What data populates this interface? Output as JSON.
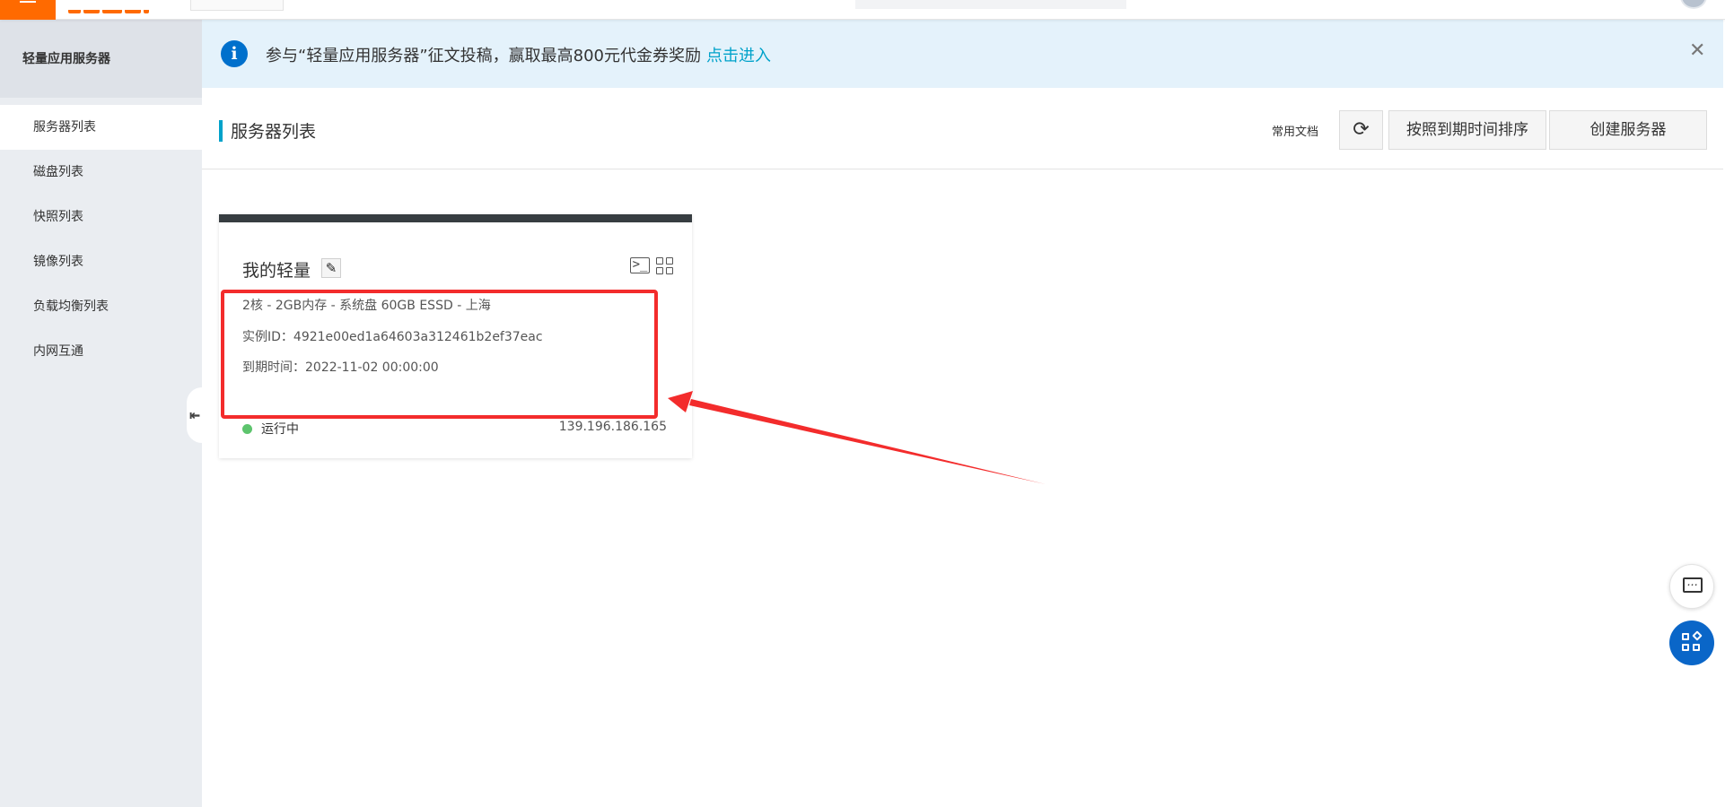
{
  "sidebar": {
    "title": "轻量应用服务器",
    "items": [
      {
        "label": "服务器列表",
        "active": true
      },
      {
        "label": "磁盘列表"
      },
      {
        "label": "快照列表"
      },
      {
        "label": "镜像列表"
      },
      {
        "label": "负载均衡列表"
      },
      {
        "label": "内网互通"
      }
    ]
  },
  "notice": {
    "text": "参与“轻量应用服务器”征文投稿，赢取最高800元代金券奖励",
    "link": "点击进入",
    "close": "✕"
  },
  "header": {
    "title": "服务器列表",
    "docs": "常用文档",
    "refresh_icon": "⟳",
    "sort_label": "按照到期时间排序",
    "create_label": "创建服务器"
  },
  "server": {
    "name": "我的轻量",
    "spec": "2核 - 2GB内存 - 系统盘 60GB ESSD - 上海",
    "instance_id_label": "实例ID：",
    "instance_id": "4921e00ed1a64603a312461b2ef37eac",
    "expiry_label": "到期时间：",
    "expiry": "2022-11-02 00:00:00",
    "status": "运行中",
    "ip": "139.196.186.165"
  },
  "colors": {
    "accent": "#00a2ca",
    "brand": "#ff6a00",
    "status_running": "#5dc46d",
    "annotation": "#f32c2c"
  },
  "icons": {
    "edit": "pencil-icon",
    "terminal": "terminal-icon",
    "grid": "grid-icon",
    "info": "info-icon",
    "close": "close-icon",
    "refresh": "refresh-icon",
    "chat": "chat-icon",
    "apps": "apps-icon"
  }
}
